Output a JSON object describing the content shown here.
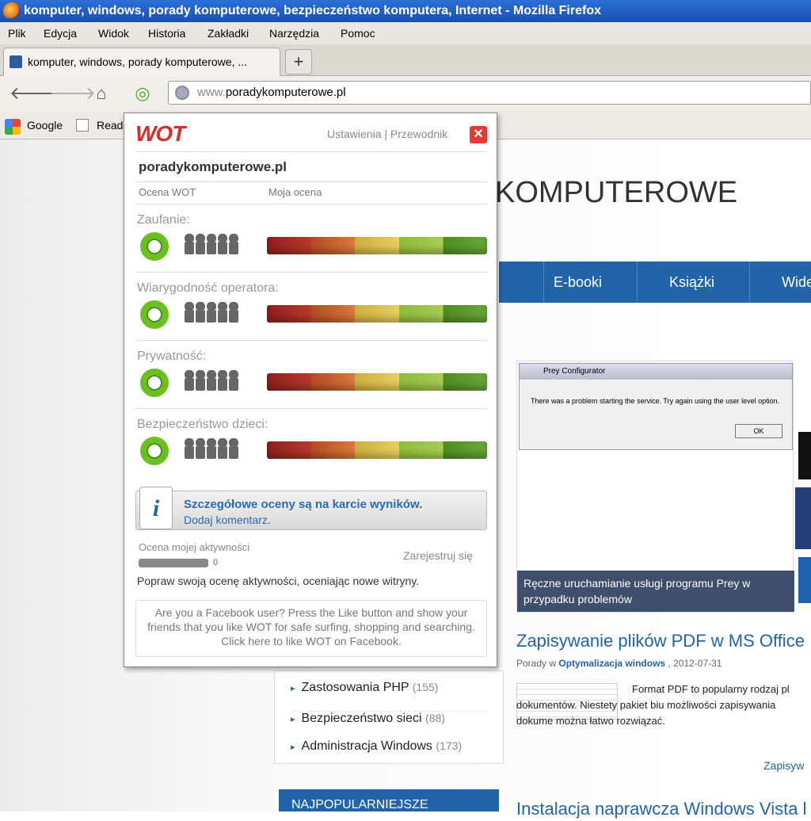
{
  "window": {
    "title": "komputer, windows, porady komputerowe, bezpieczeństwo komputera, Internet - Mozilla Firefox"
  },
  "menu": [
    "Plik",
    "Edycja",
    "Widok",
    "Historia",
    "Zakładki",
    "Narzędzia",
    "Pomoc"
  ],
  "tab": {
    "label": "komputer, windows, porady komputerowe, ...",
    "new_tab": "+"
  },
  "nav": {
    "url_prefix": "www.",
    "url_domain": "poradykomputerowe.pl"
  },
  "bookmarks": [
    "Google",
    "Read"
  ],
  "site": {
    "header": "KOMPUTEROWE",
    "nav": [
      "E-booki",
      "Książki",
      "Wide"
    ],
    "dialog_title": "Prey Configurator",
    "dialog_msg": "There was a problem starting the service. Try again using the user level option.",
    "dialog_ok": "OK",
    "caption": "Ręczne uruchamianie usługi programu Prey w przypadku problemów",
    "article_title": "Zapisywanie plików PDF w MS Office",
    "article_meta_prefix": "Porady w",
    "article_meta_cat": "Optymalizacja windows",
    "article_meta_date": ", 2012-07-31",
    "article_text": "Format PDF to popularny rodzaj pl dokumentów. Niestety pakiet biu możliwości zapisywania dokume można łatwo rozwiązać.",
    "more_link": "Zapisyw",
    "article_title2": "Instalacja naprawcza Windows Vista l",
    "categories": [
      {
        "label": "Zastosowania PHP",
        "count": "(155)"
      },
      {
        "label": "Bezpieczeństwo sieci",
        "count": "(88)"
      },
      {
        "label": "Administracja Windows",
        "count": "(173)"
      }
    ],
    "popular": "NAJPOPULARNIEJSZE"
  },
  "wot": {
    "logo": "WOT",
    "links": "Ustawienia | Przewodnik",
    "domain": "poradykomputerowe.pl",
    "col_wot": "Ocena WOT",
    "col_mine": "Moja ocena",
    "categories": [
      "Zaufanie:",
      "Wiarygodność operatora:",
      "Prywatność:",
      "Bezpieczeństwo dzieci:"
    ],
    "info_line1": "Szczegółowe oceny są na karcie wyników.",
    "info_line2": "Dodaj komentarz.",
    "activity_label": "Ocena mojej aktywności",
    "activity_value": "0",
    "register": "Zarejestruj się",
    "activity_tip": "Popraw swoją ocenę aktywności, oceniając nowe witryny.",
    "facebook": "Are you a Facebook user? Press the Like button and show your friends that you like WOT for safe surfing, shopping and searching. Click here to like WOT on Facebook."
  }
}
